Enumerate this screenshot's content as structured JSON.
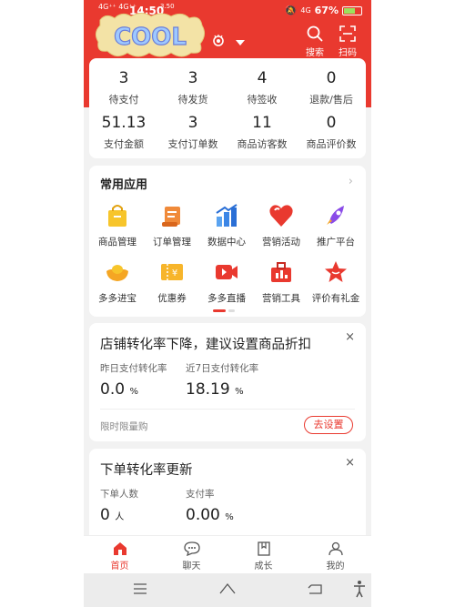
{
  "statusbar": {
    "signal_left": "4G⁺⁺ 4G⁺⁺",
    "time": "14:50",
    "speed": "3.50",
    "net": "4G",
    "battery": "67%",
    "battery_level": 0.67
  },
  "header": {
    "sticker_text": "COOL",
    "search_label": "搜索",
    "scan_label": "扫码"
  },
  "stats": [
    {
      "value": "3",
      "label": "待支付"
    },
    {
      "value": "3",
      "label": "待发货"
    },
    {
      "value": "4",
      "label": "待签收"
    },
    {
      "value": "0",
      "label": "退款/售后"
    },
    {
      "value": "51.13",
      "label": "支付金额"
    },
    {
      "value": "3",
      "label": "支付订单数"
    },
    {
      "value": "11",
      "label": "商品访客数"
    },
    {
      "value": "0",
      "label": "商品评价数"
    }
  ],
  "apps": {
    "title": "常用应用",
    "more": "›",
    "items": [
      {
        "label": "商品管理",
        "icon": "bag-icon"
      },
      {
        "label": "订单管理",
        "icon": "scroll-icon"
      },
      {
        "label": "数据中心",
        "icon": "bar-chart-icon"
      },
      {
        "label": "营销活动",
        "icon": "heart-icon"
      },
      {
        "label": "推广平台",
        "icon": "rocket-icon"
      },
      {
        "label": "多多进宝",
        "icon": "ingot-icon"
      },
      {
        "label": "优惠券",
        "icon": "coupon-icon"
      },
      {
        "label": "多多直播",
        "icon": "video-icon"
      },
      {
        "label": "营销工具",
        "icon": "toolbox-icon"
      },
      {
        "label": "评价有礼金",
        "icon": "star-icon"
      }
    ]
  },
  "tip1": {
    "title": "店铺转化率下降，建议设置商品折扣",
    "close": "×",
    "metric1_label": "昨日支付转化率",
    "metric1_value": "0.0",
    "metric1_unit": "%",
    "metric2_label": "近7日支付转化率",
    "metric2_value": "18.19",
    "metric2_unit": "%",
    "note": "限时限量购",
    "button": "去设置"
  },
  "tip2": {
    "title": "下单转化率更新",
    "close": "×",
    "metric1_label": "下单人数",
    "metric1_value": "0",
    "metric1_unit": "人",
    "metric2_label": "支付率",
    "metric2_value": "0.00",
    "metric2_unit": "%"
  },
  "bottomnav": [
    {
      "label": "首页",
      "icon": "home-icon",
      "active": true
    },
    {
      "label": "聊天",
      "icon": "chat-icon",
      "active": false
    },
    {
      "label": "成长",
      "icon": "book-icon",
      "active": false
    },
    {
      "label": "我的",
      "icon": "user-icon",
      "active": false
    }
  ],
  "colors": {
    "brand_red": "#e9392f",
    "background": "#f2f2f2"
  }
}
